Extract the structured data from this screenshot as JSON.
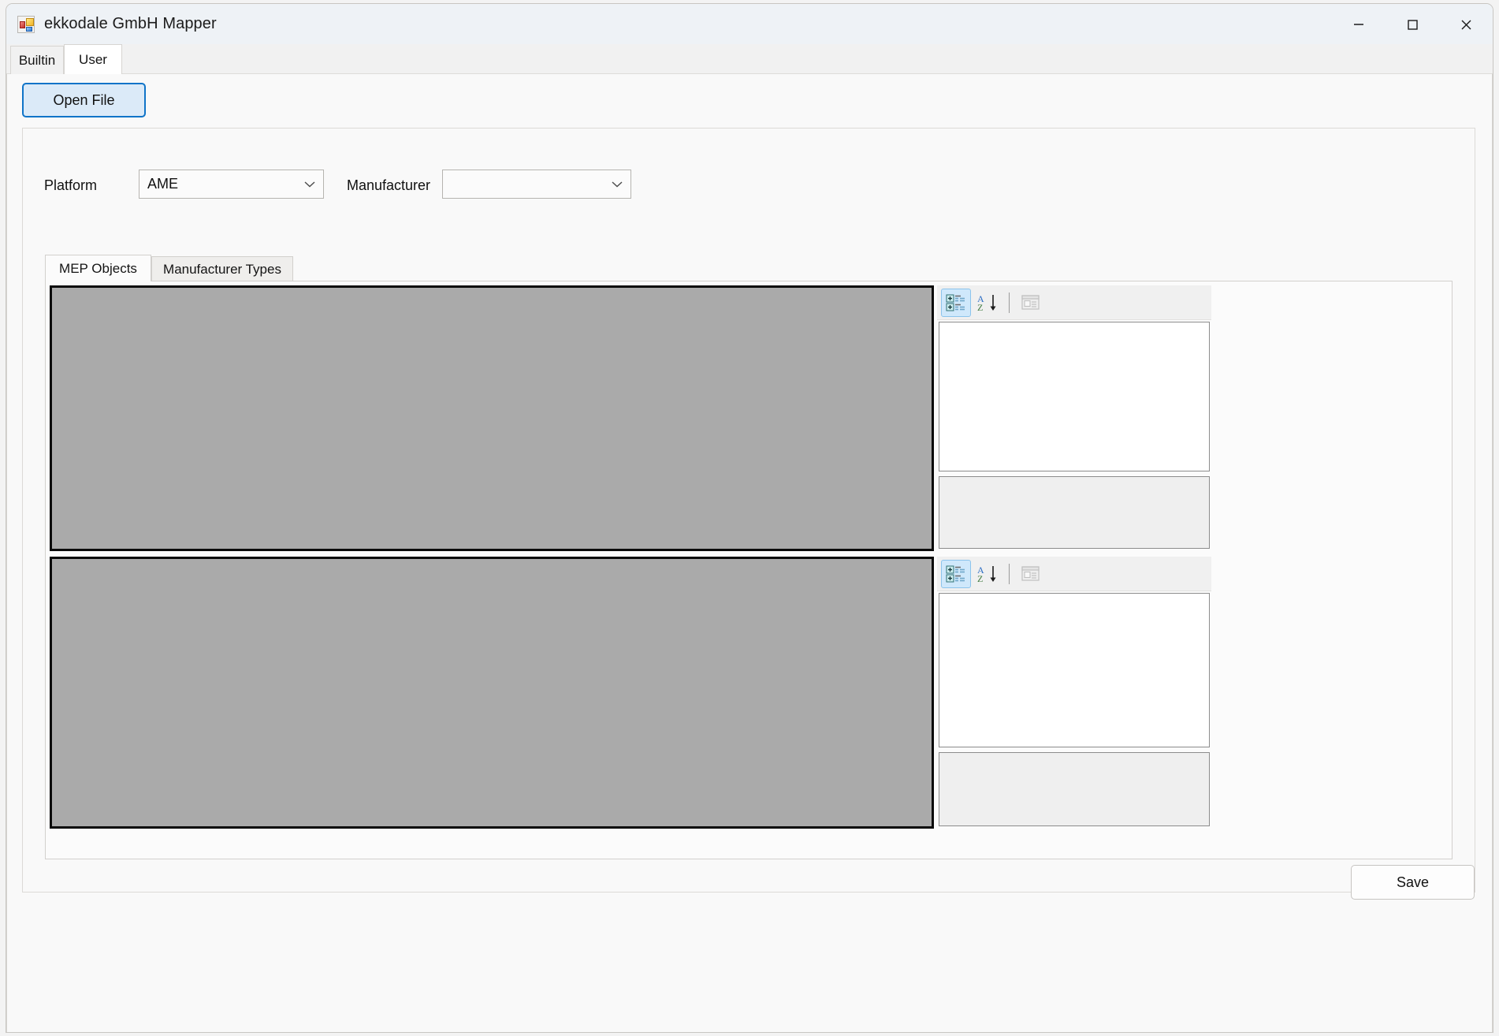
{
  "window": {
    "title": "ekkodale GmbH Mapper",
    "app_icon": "windows-forms-app-icon",
    "controls": {
      "minimize": "minimize-icon",
      "maximize": "maximize-icon",
      "close": "close-icon"
    }
  },
  "outer_tabs": [
    {
      "label": "Builtin",
      "active": false
    },
    {
      "label": "User",
      "active": true
    }
  ],
  "toolbar": {
    "open_file_label": "Open File"
  },
  "form": {
    "platform": {
      "label": "Platform",
      "value": "AME",
      "placeholder": "",
      "arrow_icon": "chevron-down-icon"
    },
    "manufacturer": {
      "label": "Manufacturer",
      "value": "",
      "placeholder": "",
      "arrow_icon": "chevron-down-icon"
    }
  },
  "inner_tabs": [
    {
      "label": "MEP Objects",
      "active": true
    },
    {
      "label": "Manufacturer Types",
      "active": false
    }
  ],
  "panels": {
    "upper_list": {
      "items": [],
      "enabled": false
    },
    "lower_list": {
      "items": [],
      "enabled": false
    }
  },
  "property_grids": [
    {
      "name": "upper",
      "toolbar": [
        {
          "icon": "categorized-view-icon",
          "label": "Categorized",
          "selected": true,
          "disabled": false
        },
        {
          "icon": "alphabetical-sort-icon",
          "label": "Alphabetical",
          "selected": false,
          "disabled": false
        },
        {
          "icon": "property-pages-icon",
          "label": "Property Pages",
          "selected": false,
          "disabled": true
        }
      ],
      "rows": [],
      "description": ""
    },
    {
      "name": "lower",
      "toolbar": [
        {
          "icon": "categorized-view-icon",
          "label": "Categorized",
          "selected": true,
          "disabled": false
        },
        {
          "icon": "alphabetical-sort-icon",
          "label": "Alphabetical",
          "selected": false,
          "disabled": false
        },
        {
          "icon": "property-pages-icon",
          "label": "Property Pages",
          "selected": false,
          "disabled": true
        }
      ],
      "rows": [],
      "description": ""
    }
  ],
  "footer": {
    "save_label": "Save"
  },
  "colors": {
    "accent": "#0f74c8",
    "focus_fill": "#dbeaf8",
    "disabled_list": "#aaaaaa",
    "toolbar_selected": "#cfe8fb",
    "window_bg": "#f9f9f9",
    "titlebar_bg": "#eef2f6"
  }
}
